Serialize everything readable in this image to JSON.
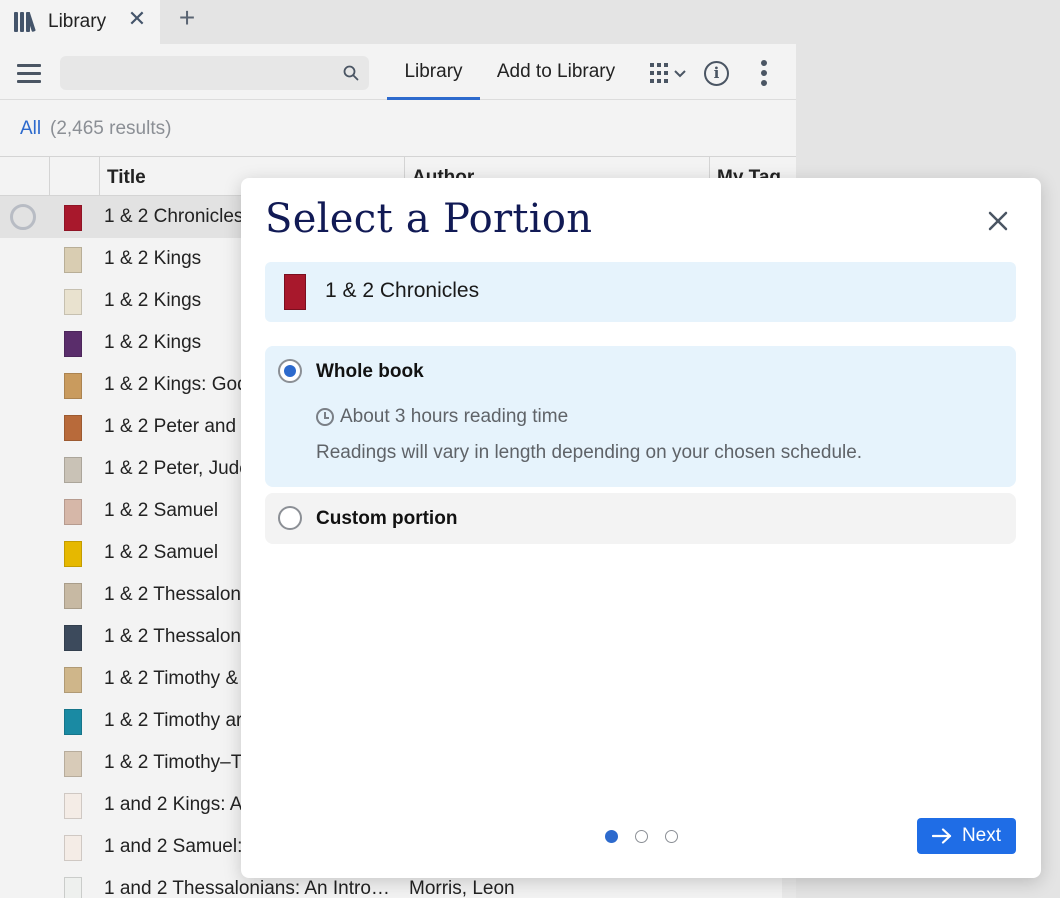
{
  "tab": {
    "title": "Library"
  },
  "toolbar": {
    "search_placeholder": "",
    "nav_tabs": [
      {
        "label": "Library",
        "active": true
      },
      {
        "label": "Add to Library",
        "active": false
      }
    ]
  },
  "filter": {
    "scope": "All",
    "count": "(2,465 results)"
  },
  "table": {
    "columns": [
      "Title",
      "Author",
      "My Tag"
    ],
    "rows": [
      {
        "title": "1 & 2 Chronicles",
        "author": "",
        "cover": "#a8182c",
        "selected": true
      },
      {
        "title": "1 & 2 Kings",
        "author": "",
        "cover": "#d9cdb2"
      },
      {
        "title": "1 & 2 Kings",
        "author": "",
        "cover": "#e9e2cf"
      },
      {
        "title": "1 & 2 Kings",
        "author": "",
        "cover": "#5a2d6b"
      },
      {
        "title": "1 & 2 Kings: God",
        "author": "",
        "cover": "#c99b5e"
      },
      {
        "title": "1 & 2 Peter and J",
        "author": "",
        "cover": "#b86a3a"
      },
      {
        "title": "1 & 2 Peter, Jude",
        "author": "",
        "cover": "#c9c2b6"
      },
      {
        "title": "1 & 2 Samuel",
        "author": "",
        "cover": "#d6b7a8"
      },
      {
        "title": "1 & 2 Samuel",
        "author": "",
        "cover": "#e6b800"
      },
      {
        "title": "1 & 2 Thessaloni",
        "author": "",
        "cover": "#c7b9a3"
      },
      {
        "title": "1 & 2 Thessaloni",
        "author": "",
        "cover": "#3c4a5c"
      },
      {
        "title": "1 & 2 Timothy &",
        "author": "",
        "cover": "#cfb68a"
      },
      {
        "title": "1 & 2 Timothy ar",
        "author": "",
        "cover": "#1a8aa3"
      },
      {
        "title": "1 & 2 Timothy–T",
        "author": "",
        "cover": "#d8cbb8"
      },
      {
        "title": "1 and 2 Kings: A",
        "author": "",
        "cover": "#f4ece6"
      },
      {
        "title": "1 and 2 Samuel:",
        "author": "",
        "cover": "#f4ece6"
      },
      {
        "title": "1 and 2 Thessalonians: An Intro…",
        "author": "Morris, Leon",
        "cover": "#eef0ee"
      }
    ]
  },
  "modal": {
    "title": "Select a Portion",
    "book_title": "1 & 2 Chronicles",
    "options": {
      "whole": {
        "label": "Whole book",
        "time": "About 3 hours reading time",
        "description": "Readings will vary in length depending on your chosen schedule."
      },
      "custom": {
        "label": "Custom portion"
      }
    },
    "selected_option": "whole",
    "steps_total": 3,
    "step_current": 1,
    "next_label": "Next"
  },
  "colors": {
    "accent": "#2d6acd",
    "modal_title": "#111a55",
    "banner_bg": "#e6f3fc",
    "button_bg": "#1f6de6"
  }
}
